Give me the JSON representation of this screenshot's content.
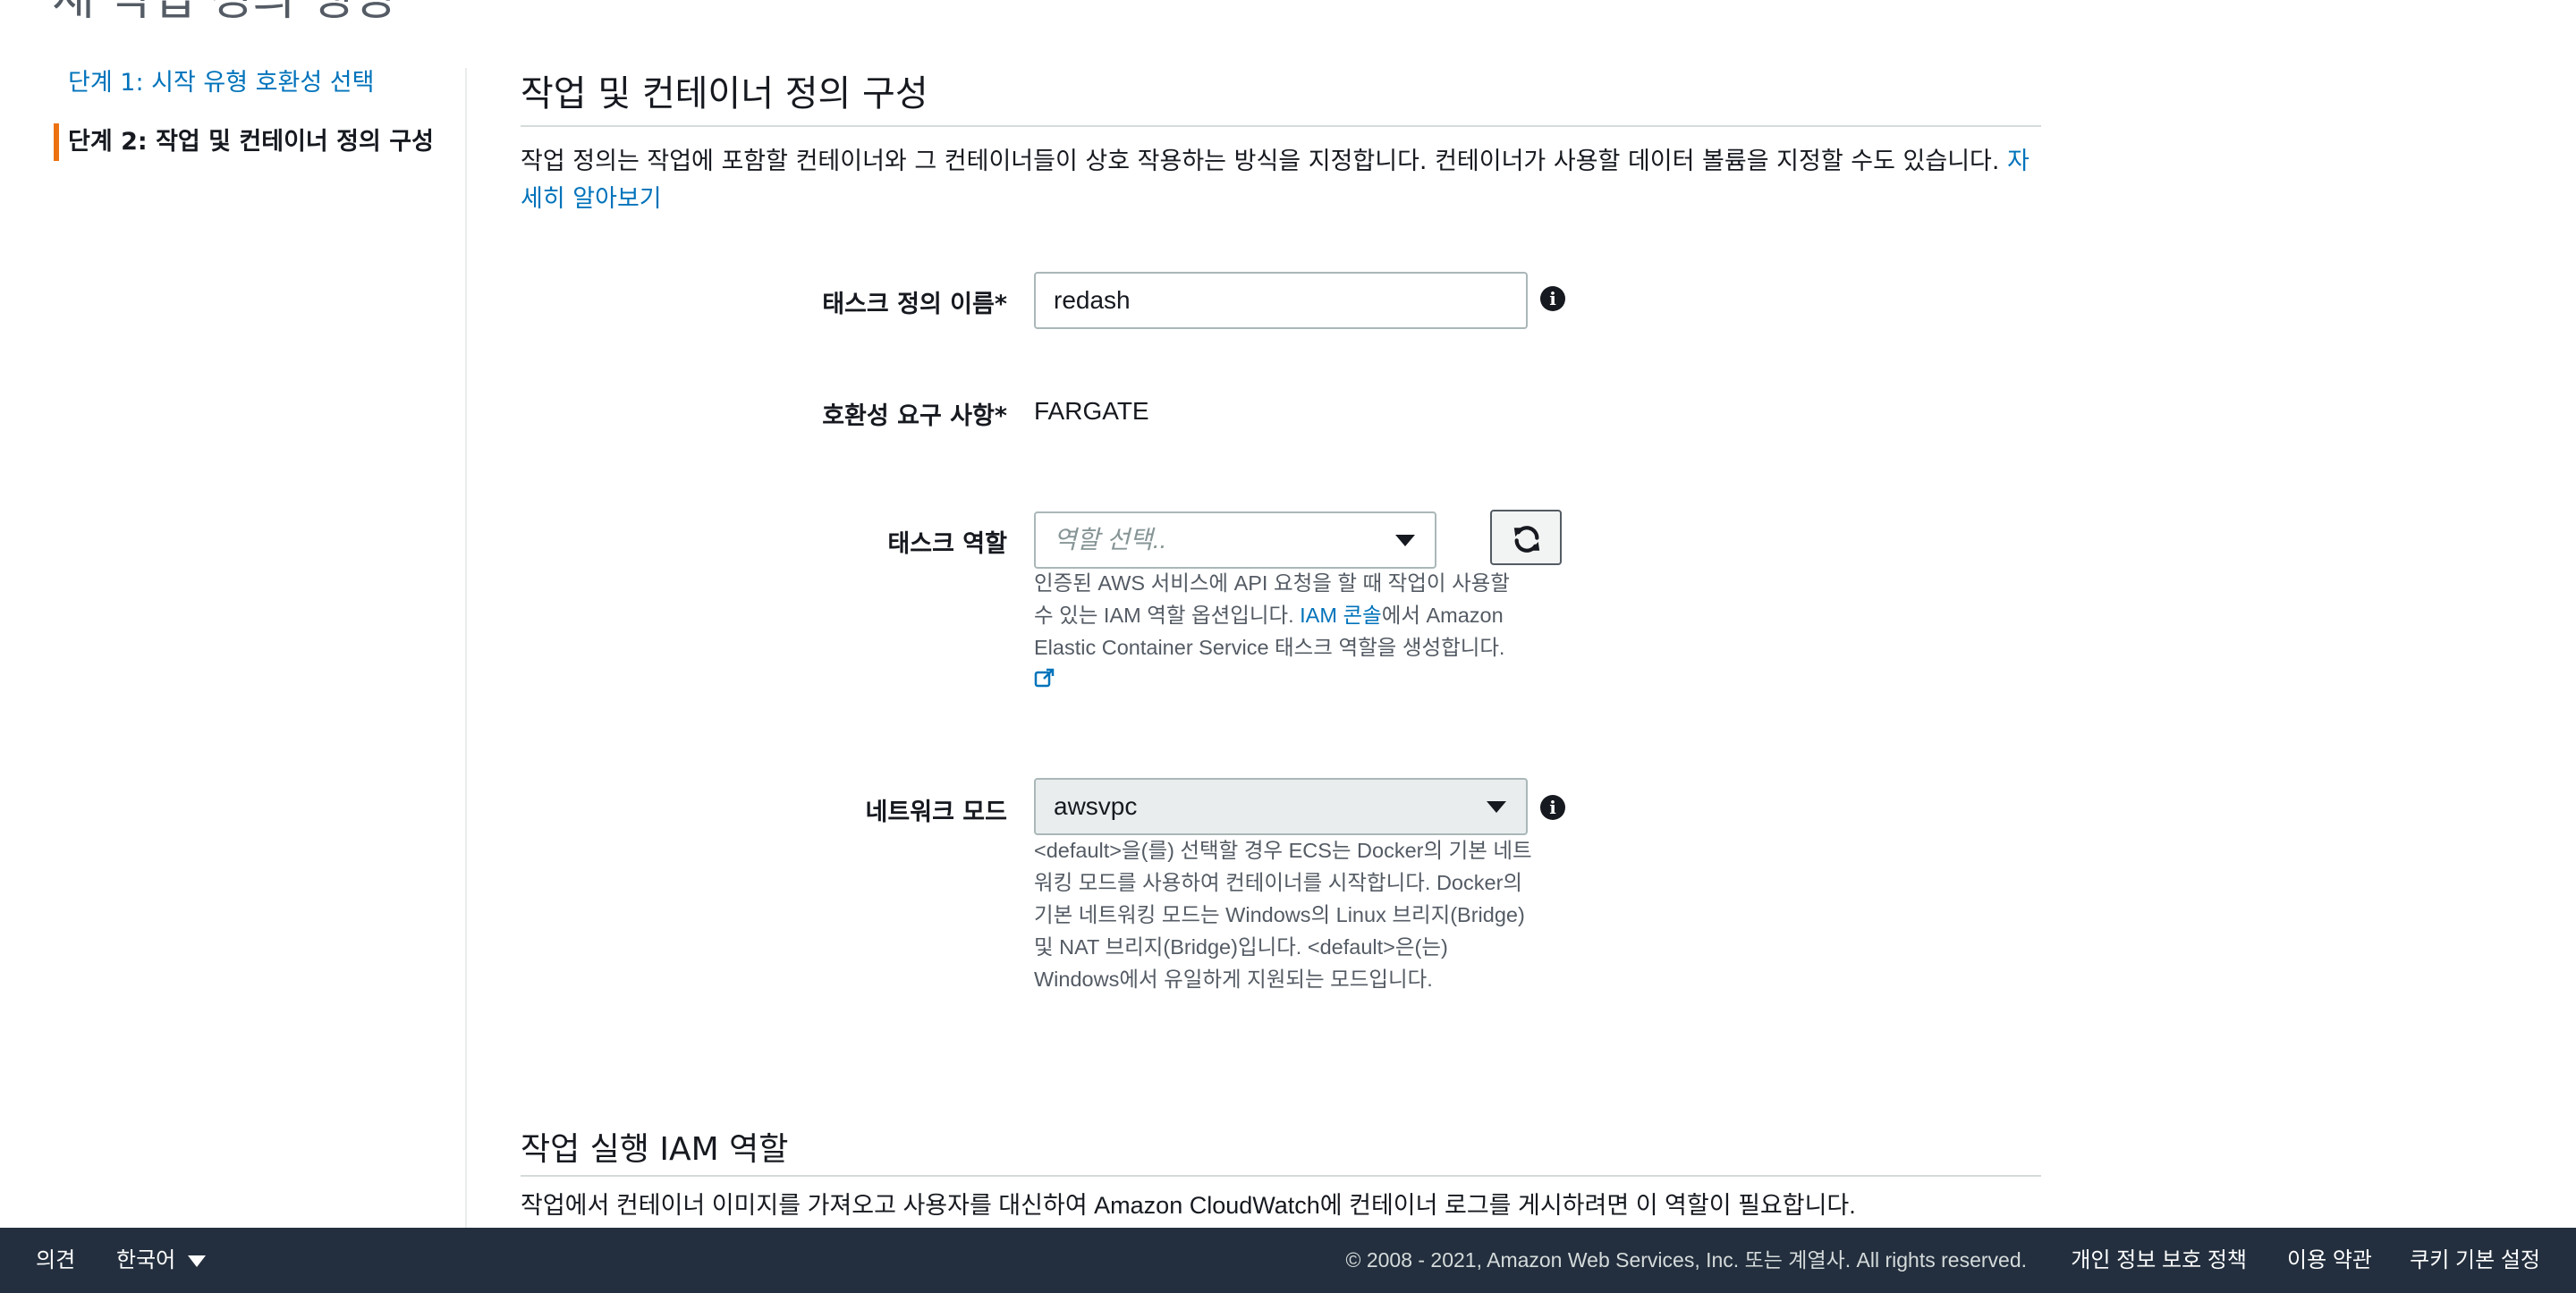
{
  "page": {
    "heading_clipped": "새 작업 정의 생성"
  },
  "steps": {
    "step1_label": "단계 1: 시작 유형 호환성 선택",
    "step2_label": "단계 2: 작업 및 컨테이너 정의 구성"
  },
  "section": {
    "title": "작업 및 컨테이너 정의 구성",
    "description": "작업 정의는 작업에 포함할 컨테이너와 그 컨테이너들이 상호 작용하는 방식을 지정합니다. 컨테이너가 사용할 데이터 볼륨을 지정할 수도 있습니다. ",
    "learn_more": "자세히 알아보기"
  },
  "form": {
    "task_def_name": {
      "label": "태스크 정의 이름*",
      "value": "redash"
    },
    "compat": {
      "label": "호환성 요구 사항*",
      "value": "FARGATE"
    },
    "task_role": {
      "label": "태스크 역할",
      "placeholder": "역할 선택..",
      "help_part1": "인증된 AWS 서비스에 API 요청을 할 때 작업이 사용할 수 있는 IAM 역할 옵션입니다. ",
      "help_link": "IAM 콘솔",
      "help_part2": "에서 Amazon Elastic Container Service 태스크 역할을 생성합니다."
    },
    "network_mode": {
      "label": "네트워크 모드",
      "value": "awsvpc",
      "help": "<default>을(를) 선택할 경우 ECS는 Docker의 기본 네트워킹 모드를 사용하여 컨테이너를 시작합니다. Docker의 기본 네트워킹 모드는 Windows의 Linux 브리지(Bridge) 및 NAT 브리지(Bridge)입니다. <default>은(는) Windows에서 유일하게 지원되는 모드입니다."
    }
  },
  "section2": {
    "title": "작업 실행 IAM 역할",
    "description": "작업에서 컨테이너 이미지를 가져오고 사용자를 대신하여 Amazon CloudWatch에 컨테이너 로그를 게시하려면 이 역할이 필요합니다."
  },
  "footer": {
    "feedback": "의견",
    "language": "한국어",
    "copyright": "© 2008 - 2021, Amazon Web Services, Inc. 또는 계열사. All rights reserved.",
    "privacy": "개인 정보 보호 정책",
    "terms": "이용 약관",
    "cookies": "쿠키 기본 설정"
  },
  "colors": {
    "link": "#0073bb",
    "active_step_bar": "#ec7211",
    "footer_bg": "#232f3e"
  },
  "icons": {
    "info": "info-icon",
    "refresh": "refresh-icon",
    "external_link": "external-link-icon",
    "dropdown": "caret-down-icon"
  }
}
